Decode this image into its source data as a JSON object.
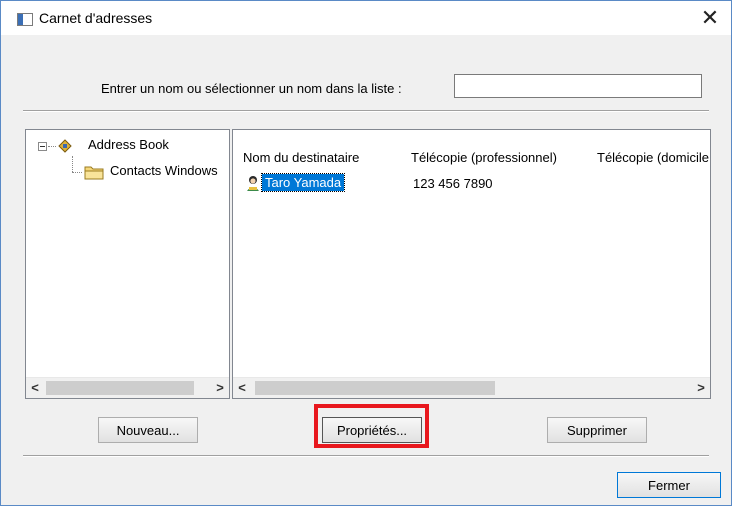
{
  "window": {
    "title": "Carnet d'adresses",
    "close_symbol": "✕"
  },
  "search": {
    "label": "Entrer un nom ou sélectionner un nom dans la liste :",
    "value": "",
    "placeholder": ""
  },
  "tree": {
    "root_label": "Address Book",
    "child_label": "Contacts Windows",
    "root_icon": "address-book-icon",
    "child_icon": "folder-icon"
  },
  "list": {
    "columns": [
      "Nom du destinataire",
      "Télécopie (professionnel)",
      "Télécopie (domicile)"
    ],
    "rows": [
      {
        "name": "Taro Yamada",
        "fax": "123 456 7890",
        "icon": "contact-icon",
        "selected": true
      }
    ]
  },
  "scrollbars": {
    "left_arrow": "<",
    "right_arrow": ">"
  },
  "buttons": {
    "new": "Nouveau...",
    "properties": "Propriétés...",
    "delete": "Supprimer",
    "close": "Fermer"
  },
  "colors": {
    "highlight": "#e8171d",
    "selection": "#0078d7",
    "window_border": "#5a8ac6"
  }
}
